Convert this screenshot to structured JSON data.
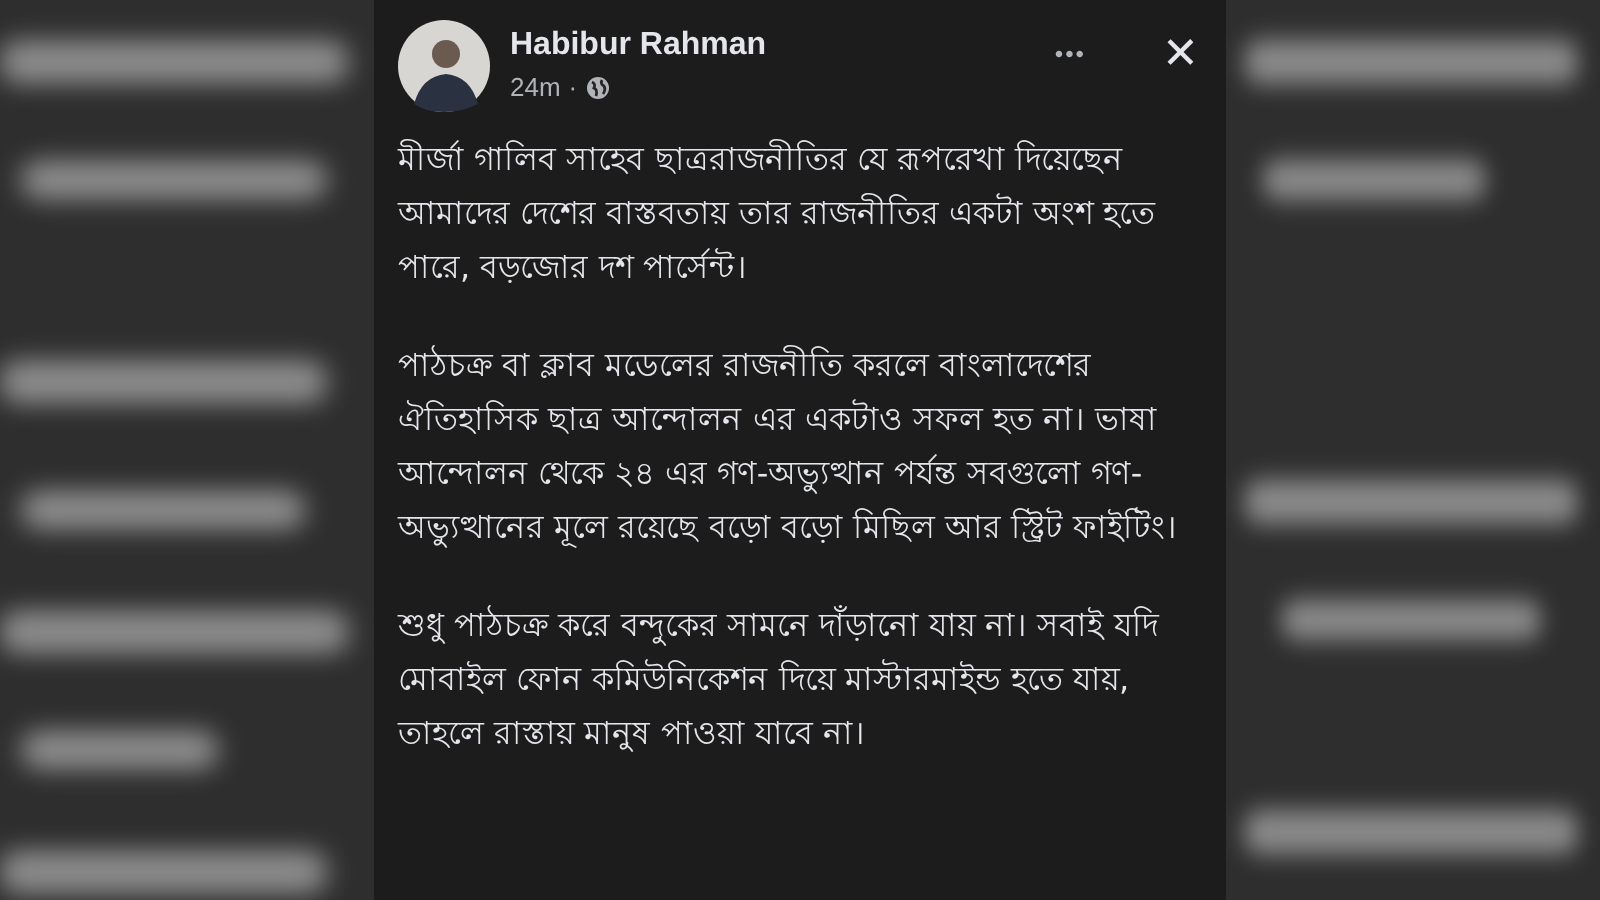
{
  "post": {
    "author": "Habibur Rahman",
    "time": "24m",
    "separator": "·",
    "more": "•••",
    "close": "✕",
    "paragraphs": [
      "মীর্জা গালিব সাহেব ছাত্ররাজনীতির যে রূপরেখা দিয়েছেন আমাদের দেশের বাস্তবতায় তার রাজনীতির একটা অংশ হতে পারে, বড়জোর দশ পার্সেন্ট।",
      "পাঠচক্র বা ক্লাব মডেলের রাজনীতি করলে বাংলাদেশের ঐতিহাসিক ছাত্র আন্দোলন এর একটাও সফল হত না। ভাষা আন্দোলন থেকে ২৪ এর গণ-অভ্যুত্থান পর্যন্ত সবগুলো গণ-অভ্যুত্থানের মূলে রয়েছে বড়ো বড়ো মিছিল আর স্ট্রিট ফাইটিং।",
      "শুধু পাঠচক্র করে বন্দুকের সামনে দাঁড়ানো যায় না। সবাই যদি মোবাইল ফোন কমিউনিকেশন দিয়ে মাস্টারমাইন্ড হতে যায়, তাহলে রাস্তায় মানুষ পাওয়া যাবে না।"
    ]
  }
}
